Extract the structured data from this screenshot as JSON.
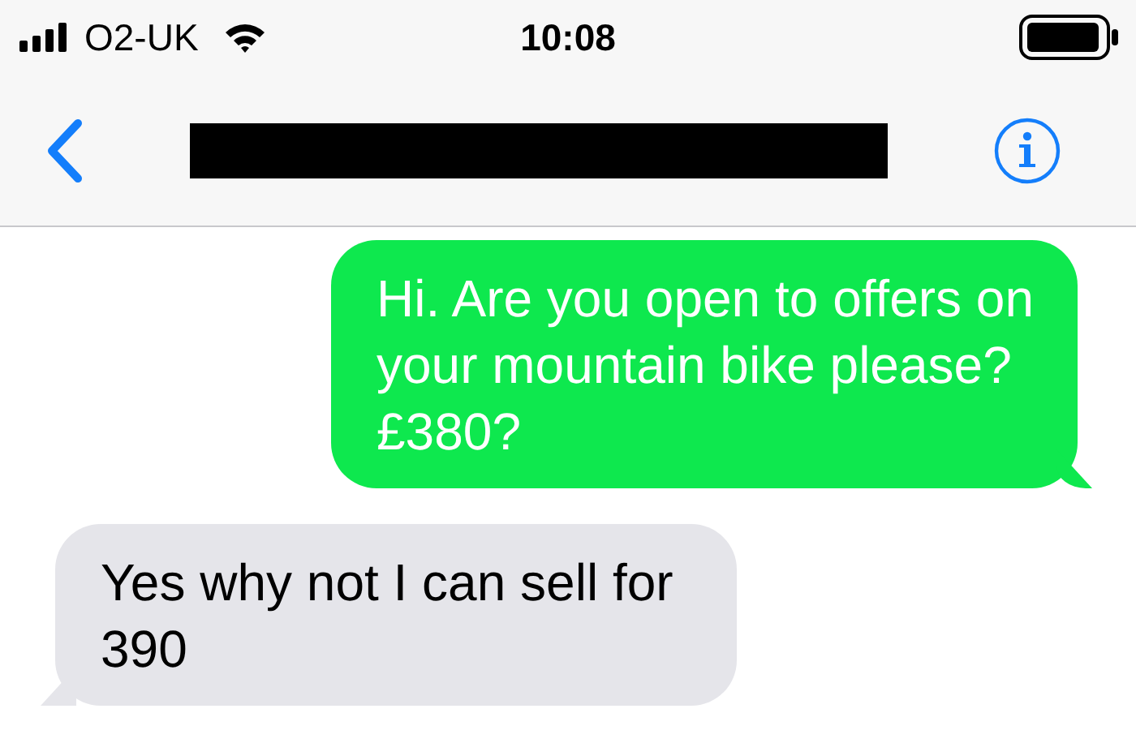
{
  "status_bar": {
    "carrier": "O2-UK",
    "time": "10:08"
  },
  "nav": {
    "title_redacted": true
  },
  "messages": [
    {
      "kind": "sent",
      "text": "Hi. Are you open to offers on your mountain bike please? £380?"
    },
    {
      "kind": "received",
      "text": "Yes why not I can sell for 390"
    }
  ]
}
